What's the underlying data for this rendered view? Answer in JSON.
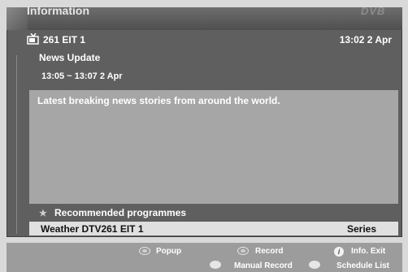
{
  "window": {
    "title": "Information",
    "logo": "DVB"
  },
  "channel": {
    "icon": "tv-antenna-icon",
    "label": "261 EIT 1",
    "clock": "13:02 2 Apr"
  },
  "programme": {
    "title": "News Update",
    "time": "13:05 ~ 13:07 2 Apr",
    "description": "Latest breaking news stories from around the world."
  },
  "recommended": {
    "star": "★",
    "label": "Recommended programmes",
    "items": [
      {
        "name": "Weather DTV261 EIT 1",
        "tag": "Series"
      }
    ]
  },
  "footer": {
    "popup": "Popup",
    "record": "Record",
    "info_exit": "Info. Exit",
    "info_glyph": "i",
    "manual_record": "Manual Record",
    "schedule_list": "Schedule List"
  }
}
